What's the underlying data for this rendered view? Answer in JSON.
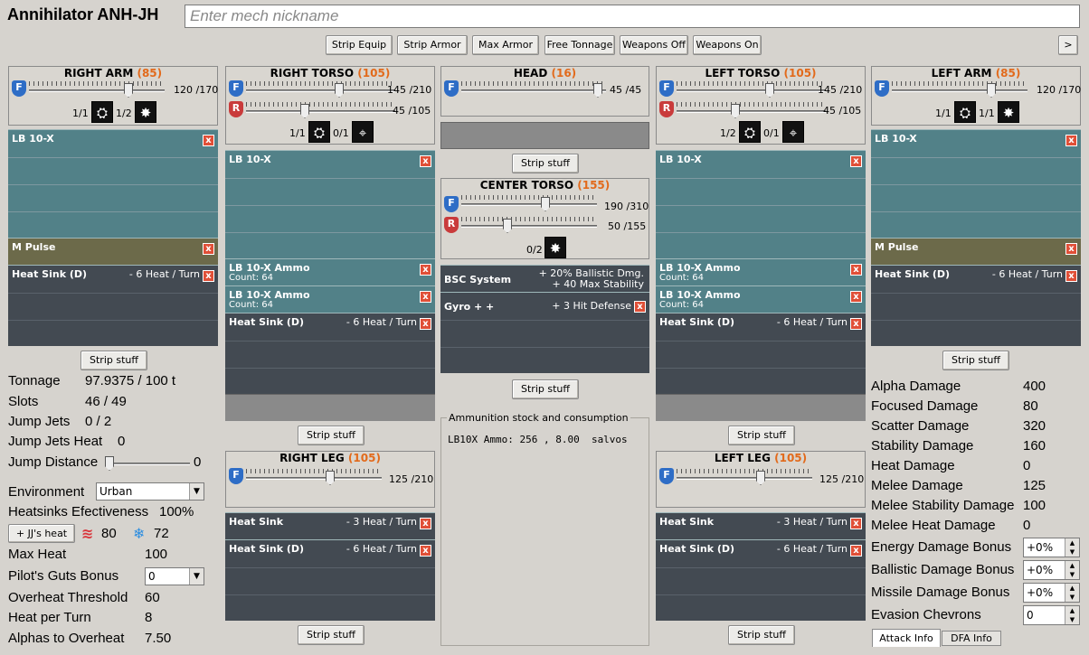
{
  "header": {
    "mech_name": "Annihilator ANH-JH",
    "nickname_placeholder": "Enter mech nickname"
  },
  "toolbar": {
    "strip_equip": "Strip Equip",
    "strip_armor": "Strip Armor",
    "max_armor": "Max Armor",
    "free_tonnage": "Free Tonnage",
    "weapons_off": "Weapons Off",
    "weapons_on": "Weapons On",
    "expand": ">"
  },
  "common": {
    "strip_stuff": "Strip stuff",
    "front_letter": "F",
    "rear_letter": "R",
    "remove": "x"
  },
  "right_arm": {
    "title": "RIGHT ARM",
    "armor": "(85)",
    "front_value": "120 /170",
    "crit1": "1/1",
    "crit2": "1/2",
    "slots": [
      {
        "name": "LB 10-X",
        "info": ""
      },
      {
        "name": "M Pulse",
        "info": ""
      },
      {
        "name": "Heat Sink (D)",
        "info": "- 6 Heat / Turn"
      }
    ]
  },
  "right_torso": {
    "title": "RIGHT TORSO",
    "armor": "(105)",
    "front_value": "145 /210",
    "rear_value": "45 /105",
    "crit1": "1/1",
    "crit2": "0/1",
    "slots": [
      {
        "name": "LB 10-X",
        "info": ""
      },
      {
        "name": "LB 10-X Ammo",
        "count": "Count: 64"
      },
      {
        "name": "LB 10-X Ammo",
        "count": "Count: 64"
      },
      {
        "name": "Heat Sink (D)",
        "info": "- 6 Heat / Turn"
      }
    ]
  },
  "head": {
    "title": "HEAD",
    "armor": "(16)",
    "front_value": "45 /45"
  },
  "center_torso": {
    "title": "CENTER TORSO",
    "armor": "(155)",
    "front_value": "190 /310",
    "rear_value": "50 /155",
    "crit1": "0/2",
    "slots": [
      {
        "name": "BSC System",
        "info": "+ 20% Ballistic Dmg.\n+ 40 Max Stability"
      },
      {
        "name": "Gyro + +",
        "info": "+ 3 Hit Defense"
      }
    ]
  },
  "left_torso": {
    "title": "LEFT TORSO",
    "armor": "(105)",
    "front_value": "145 /210",
    "rear_value": "45 /105",
    "crit1": "1/2",
    "crit2": "0/1",
    "slots": [
      {
        "name": "LB 10-X",
        "info": ""
      },
      {
        "name": "LB 10-X Ammo",
        "count": "Count: 64"
      },
      {
        "name": "LB 10-X Ammo",
        "count": "Count: 64"
      },
      {
        "name": "Heat Sink (D)",
        "info": "- 6 Heat / Turn"
      }
    ]
  },
  "left_arm": {
    "title": "LEFT ARM",
    "armor": "(85)",
    "front_value": "120 /170",
    "crit1": "1/1",
    "crit2": "1/1",
    "slots": [
      {
        "name": "LB 10-X",
        "info": ""
      },
      {
        "name": "M Pulse",
        "info": ""
      },
      {
        "name": "Heat Sink (D)",
        "info": "- 6 Heat / Turn"
      }
    ]
  },
  "right_leg": {
    "title": "RIGHT LEG",
    "armor": "(105)",
    "front_value": "125 /210",
    "slots": [
      {
        "name": "Heat Sink",
        "info": "- 3 Heat / Turn"
      },
      {
        "name": "Heat Sink (D)",
        "info": "- 6 Heat / Turn"
      }
    ]
  },
  "left_leg": {
    "title": "LEFT LEG",
    "armor": "(105)",
    "front_value": "125 /210",
    "slots": [
      {
        "name": "Heat Sink",
        "info": "- 3 Heat / Turn"
      },
      {
        "name": "Heat Sink (D)",
        "info": "- 6 Heat / Turn"
      }
    ]
  },
  "ammo_box": {
    "title": "Ammunition stock and consumption",
    "line": "LB10X Ammo: 256 , 8.00  salvos"
  },
  "stats_left": {
    "tonnage_label": "Tonnage",
    "tonnage_value": "97.9375 / 100 t",
    "slots_label": "Slots",
    "slots_value": "46 / 49",
    "jumpjets_label": "Jump Jets",
    "jumpjets_value": "0 / 2",
    "jjheat_label": "Jump Jets Heat",
    "jjheat_value": "0",
    "jumpdist_label": "Jump Distance",
    "jumpdist_value": "0",
    "environment_label": "Environment",
    "environment_value": "Urban",
    "hs_eff_label": "Heatsinks Efectiveness",
    "hs_eff_value": "100%",
    "jj_heat_button": "+ JJ's heat",
    "heat_value": "80",
    "cold_value": "72",
    "maxheat_label": "Max Heat",
    "maxheat_value": "100",
    "guts_label": "Pilot's Guts Bonus",
    "guts_value": "0",
    "overheat_label": "Overheat Threshold",
    "overheat_value": "60",
    "hpt_label": "Heat per Turn",
    "hpt_value": "8",
    "alphas_label": "Alphas to Overheat",
    "alphas_value": "7.50"
  },
  "stats_right": {
    "alpha_label": "Alpha Damage",
    "alpha_value": "400",
    "focused_label": "Focused Damage",
    "focused_value": "80",
    "scatter_label": "Scatter Damage",
    "scatter_value": "320",
    "stability_label": "Stability Damage",
    "stability_value": "160",
    "heatdmg_label": "Heat Damage",
    "heatdmg_value": "0",
    "melee_label": "Melee Damage",
    "melee_value": "125",
    "meleestab_label": "Melee Stability Damage",
    "meleestab_value": "100",
    "meleeheat_label": "Melee Heat Damage",
    "meleeheat_value": "0",
    "energy_label": "Energy Damage Bonus",
    "energy_value": "+0%",
    "ballistic_label": "Ballistic Damage Bonus",
    "ballistic_value": "+0%",
    "missile_label": "Missile Damage Bonus",
    "missile_value": "+0%",
    "evasion_label": "Evasion Chevrons",
    "evasion_value": "0",
    "tab_attack": "Attack Info",
    "tab_dfa": "DFA Info"
  }
}
